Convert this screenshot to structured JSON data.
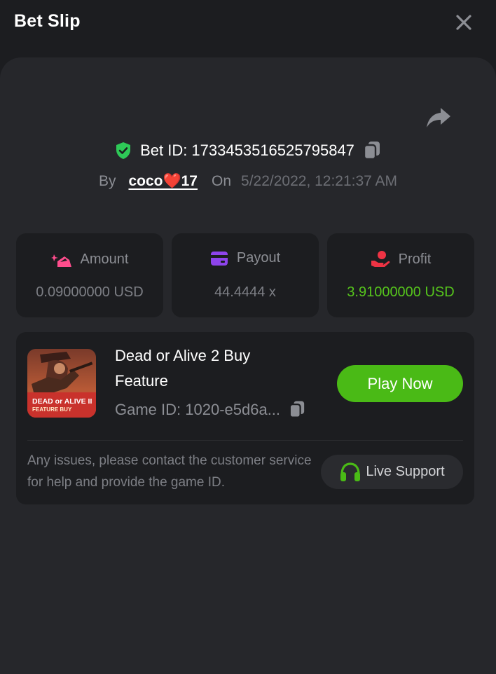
{
  "header": {
    "title": "Bet Slip"
  },
  "bet": {
    "id_text": "Bet ID: 1733453516525795847",
    "by_label": "By",
    "username": "coco❤️17",
    "on_label": "On",
    "date": "5/22/2022, 12:21:37 AM"
  },
  "stats": [
    {
      "label": "Amount",
      "value": "0.09000000 USD",
      "icon": "amount-icon",
      "color": "#ff4d8d"
    },
    {
      "label": "Payout",
      "value": "44.4444 x",
      "icon": "payout-card-icon",
      "color": "#8e44ec"
    },
    {
      "label": "Profit",
      "value": "3.91000000 USD",
      "icon": "profit-hand-icon",
      "color": "#ee3344"
    }
  ],
  "game": {
    "name": "Dead or Alive 2 Buy Feature",
    "id_text": "Game ID: 1020-e5d6a...",
    "thumb_title": "DEAD or ALIVE II",
    "thumb_subtitle": "FEATURE BUY",
    "play_label": "Play Now"
  },
  "support": {
    "text": "Any issues, please contact the customer service for help and provide the game ID.",
    "button_label": "Live Support"
  },
  "colors": {
    "background": "#1c1d20",
    "panel": "#26272b",
    "accent_green": "#4aba16",
    "profit_green": "#56c51c",
    "shield_green": "#2ec957"
  }
}
